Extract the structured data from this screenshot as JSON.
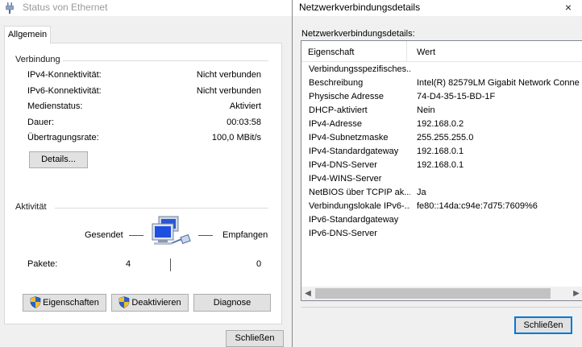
{
  "status_window": {
    "title": "Status von Ethernet",
    "tab": "Allgemein",
    "connection": {
      "heading": "Verbindung",
      "rows": [
        {
          "label": "IPv4-Konnektivität:",
          "value": "Nicht verbunden"
        },
        {
          "label": "IPv6-Konnektivität:",
          "value": "Nicht verbunden"
        },
        {
          "label": "Medienstatus:",
          "value": "Aktiviert"
        },
        {
          "label": "Dauer:",
          "value": "00:03:58"
        },
        {
          "label": "Übertragungsrate:",
          "value": "100,0 MBit/s"
        }
      ],
      "details_button": "Details..."
    },
    "activity": {
      "heading": "Aktivität",
      "sent_label": "Gesendet",
      "received_label": "Empfangen",
      "packets_label": "Pakete:",
      "packets_sent": "4",
      "packets_received": "0"
    },
    "buttons": {
      "properties": "Eigenschaften",
      "deactivate": "Deaktivieren",
      "diagnose": "Diagnose",
      "close": "Schließen"
    }
  },
  "details_window": {
    "title": "Netzwerkverbindungsdetails",
    "caption": "Netzwerkverbindungsdetails:",
    "columns": {
      "property": "Eigenschaft",
      "value": "Wert"
    },
    "rows": [
      {
        "property": "Verbindungsspezifisches...",
        "value": ""
      },
      {
        "property": "Beschreibung",
        "value": "Intel(R) 82579LM Gigabit Network Conne"
      },
      {
        "property": "Physische Adresse",
        "value": "74-D4-35-15-BD-1F"
      },
      {
        "property": "DHCP-aktiviert",
        "value": "Nein"
      },
      {
        "property": "IPv4-Adresse",
        "value": "192.168.0.2"
      },
      {
        "property": "IPv4-Subnetzmaske",
        "value": "255.255.255.0"
      },
      {
        "property": "IPv4-Standardgateway",
        "value": "192.168.0.1"
      },
      {
        "property": "IPv4-DNS-Server",
        "value": "192.168.0.1"
      },
      {
        "property": "IPv4-WINS-Server",
        "value": ""
      },
      {
        "property": "NetBIOS über TCPIP ak...",
        "value": "Ja"
      },
      {
        "property": "Verbindungslokale IPv6-...",
        "value": "fe80::14da:c94e:7d75:7609%6"
      },
      {
        "property": "IPv6-Standardgateway",
        "value": ""
      },
      {
        "property": "IPv6-DNS-Server",
        "value": ""
      }
    ],
    "close_button": "Schließen",
    "close_icon": "×"
  }
}
